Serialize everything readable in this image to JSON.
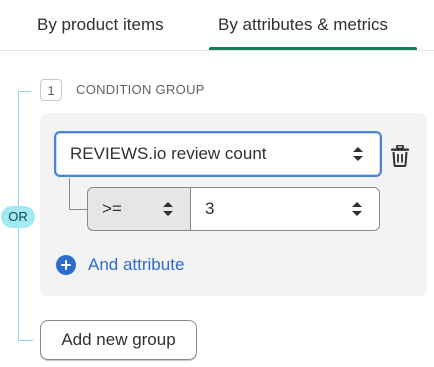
{
  "tabs": [
    {
      "label": "By product items",
      "selected": false
    },
    {
      "label": "By attributes & metrics",
      "selected": true
    }
  ],
  "group": {
    "index": "1",
    "label": "CONDITION GROUP",
    "connector_badge": "OR",
    "attribute_select": {
      "value": "REVIEWS.io review count"
    },
    "operator_select": {
      "value": ">="
    },
    "value_select": {
      "value": "3"
    },
    "add_attribute_label": "And attribute"
  },
  "add_group_label": "Add new group",
  "icons": {
    "select_chevron": "chevron-up-down-icon",
    "delete": "trash-icon",
    "add": "plus-circle-icon"
  },
  "colors": {
    "accent_tab": "#137a5d",
    "link": "#2c6ecb",
    "or_badge": "#a4e8f2",
    "focus_border": "#4b84d6"
  }
}
